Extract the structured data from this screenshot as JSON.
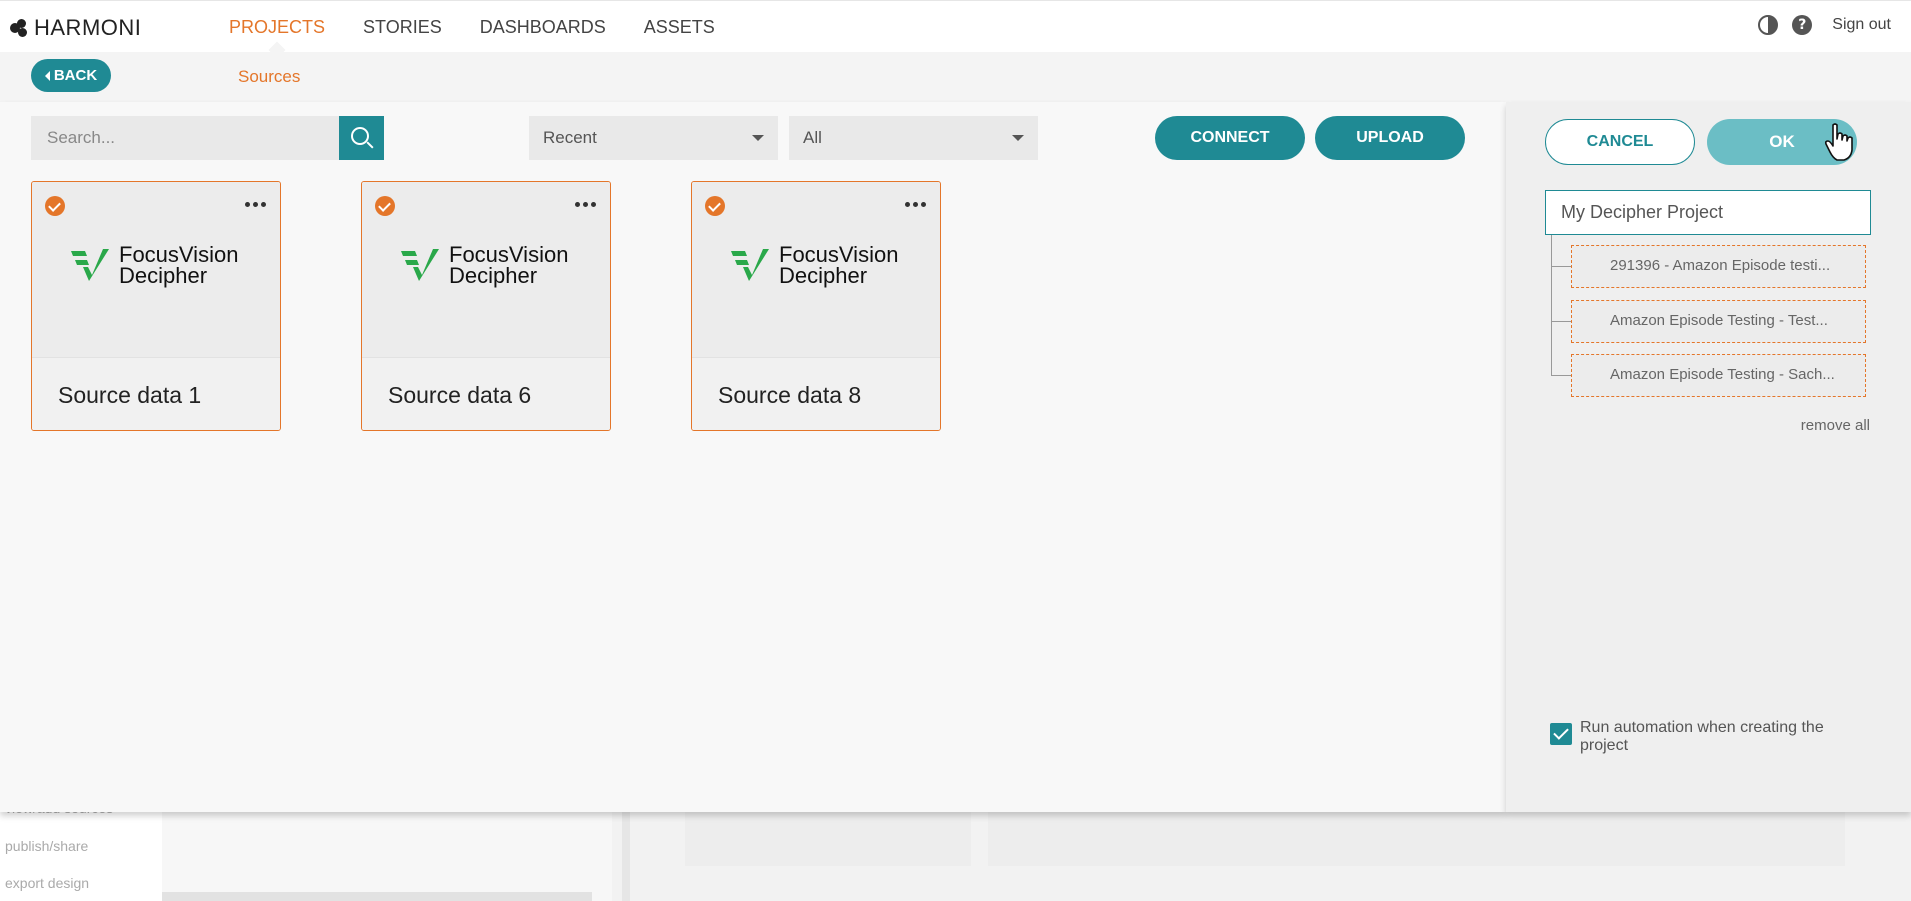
{
  "app": {
    "logo_text": "HARMONI"
  },
  "nav": {
    "items": [
      {
        "label": "PROJECTS",
        "active": true
      },
      {
        "label": "STORIES",
        "active": false
      },
      {
        "label": "DASHBOARDS",
        "active": false
      },
      {
        "label": "ASSETS",
        "active": false
      }
    ],
    "sign_out": "Sign out",
    "icons": [
      "contrast-icon",
      "help-icon"
    ]
  },
  "subbar": {
    "back_label": "BACK",
    "title": "Sources"
  },
  "toolbar": {
    "search_placeholder": "Search...",
    "sort_value": "Recent",
    "filter_value": "All",
    "connect_label": "CONNECT",
    "upload_label": "UPLOAD"
  },
  "cards": [
    {
      "title": "Source data 1",
      "logo_line1": "FocusVision",
      "logo_line2": "Decipher",
      "selected": true
    },
    {
      "title": "Source data 6",
      "logo_line1": "FocusVision",
      "logo_line2": "Decipher",
      "selected": true
    },
    {
      "title": "Source data 8",
      "logo_line1": "FocusVision",
      "logo_line2": "Decipher",
      "selected": true
    }
  ],
  "panel": {
    "cancel_label": "CANCEL",
    "ok_label": "OK",
    "project_name": "My Decipher Project",
    "items": [
      "291396 - Amazon Episode testi...",
      "Amazon Episode Testing - Test...",
      "Amazon Episode Testing - Sach..."
    ],
    "remove_all": "remove all",
    "automation_label": "Run automation when creating the project",
    "automation_checked": true
  },
  "background": {
    "side_items": [
      "view/add sources",
      "publish/share",
      "export design"
    ]
  },
  "colors": {
    "accent": "#e4762a",
    "teal": "#1f8a94",
    "teal_light": "#6bbec5"
  }
}
